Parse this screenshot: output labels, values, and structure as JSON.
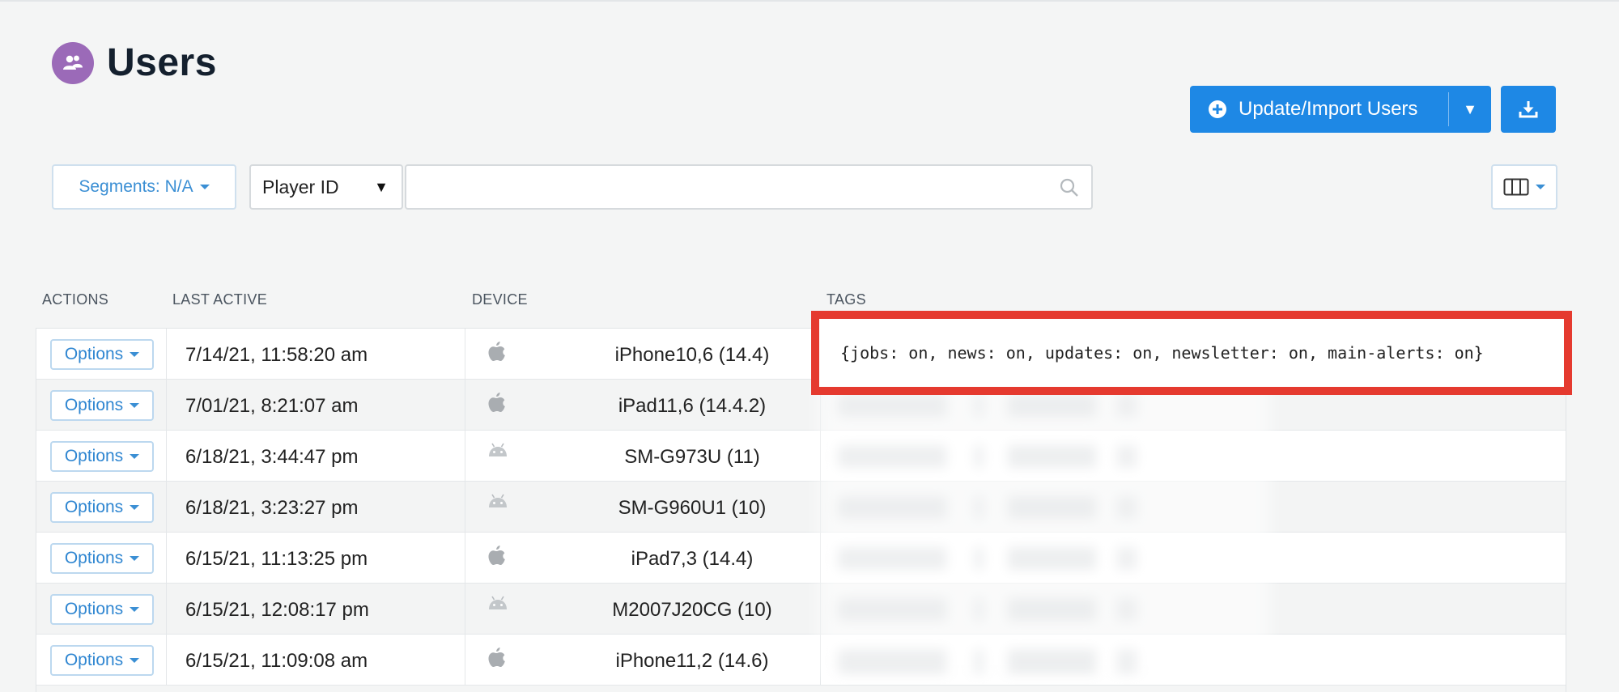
{
  "page": {
    "title": "Users"
  },
  "header": {
    "import_button": "Update/Import Users"
  },
  "filters": {
    "segments_label": "Segments: N/A",
    "field_select": "Player ID",
    "search_value": "",
    "search_placeholder": ""
  },
  "table": {
    "columns": [
      "ACTIONS",
      "LAST ACTIVE",
      "DEVICE",
      "TAGS"
    ],
    "options_label": "Options",
    "highlighted_tags": "{jobs: on, news: on, updates: on, newsletter: on, main-alerts: on}",
    "rows": [
      {
        "last_active": "7/14/21, 11:58:20 am",
        "device_os": "apple",
        "device": "iPhone10,6 (14.4)"
      },
      {
        "last_active": "7/01/21, 8:21:07 am",
        "device_os": "apple",
        "device": "iPad11,6 (14.4.2)"
      },
      {
        "last_active": "6/18/21, 3:44:47 pm",
        "device_os": "android",
        "device": "SM-G973U (11)"
      },
      {
        "last_active": "6/18/21, 3:23:27 pm",
        "device_os": "android",
        "device": "SM-G960U1 (10)"
      },
      {
        "last_active": "6/15/21, 11:13:25 pm",
        "device_os": "apple",
        "device": "iPad7,3 (14.4)"
      },
      {
        "last_active": "6/15/21, 12:08:17 pm",
        "device_os": "android",
        "device": "M2007J20CG (10)"
      },
      {
        "last_active": "6/15/21, 11:09:08 am",
        "device_os": "apple",
        "device": "iPhone11,2 (14.6)"
      }
    ]
  },
  "colors": {
    "primary": "#1e88e5",
    "highlight_border": "#e53a2f",
    "page_icon": "#9b6ab8",
    "link": "#2f86d1"
  }
}
